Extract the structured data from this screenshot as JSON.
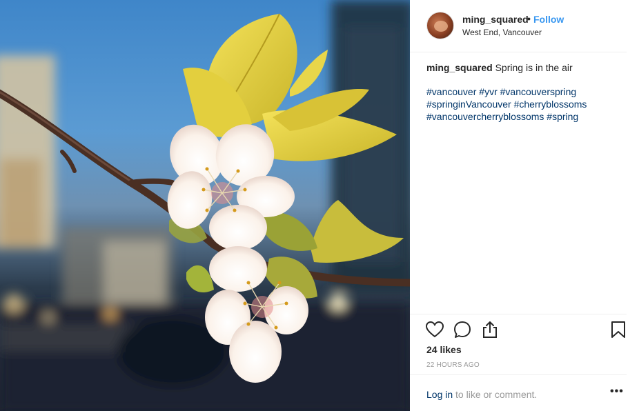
{
  "post": {
    "username": "ming_squared",
    "separator": "•",
    "follow_label": "Follow",
    "location": "West End, Vancouver",
    "caption_text": "Spring is in the air",
    "hashtags": [
      "#vancouver",
      "#yvr",
      "#vancouverspring",
      "#springinVancouver",
      "#cherryblossoms",
      "#vancouvercherryblossoms",
      "#spring"
    ],
    "likes": "24 likes",
    "time": "22 HOURS AGO"
  },
  "comment": {
    "login_link": "Log in",
    "login_rest": " to like or comment.",
    "more_label": "•••"
  },
  "colors": {
    "link": "#003569",
    "follow": "#3897f0",
    "muted": "#999999",
    "border": "#efefef"
  },
  "icons": [
    "heart-icon",
    "comment-icon",
    "share-icon",
    "bookmark-icon",
    "more-options-icon"
  ]
}
